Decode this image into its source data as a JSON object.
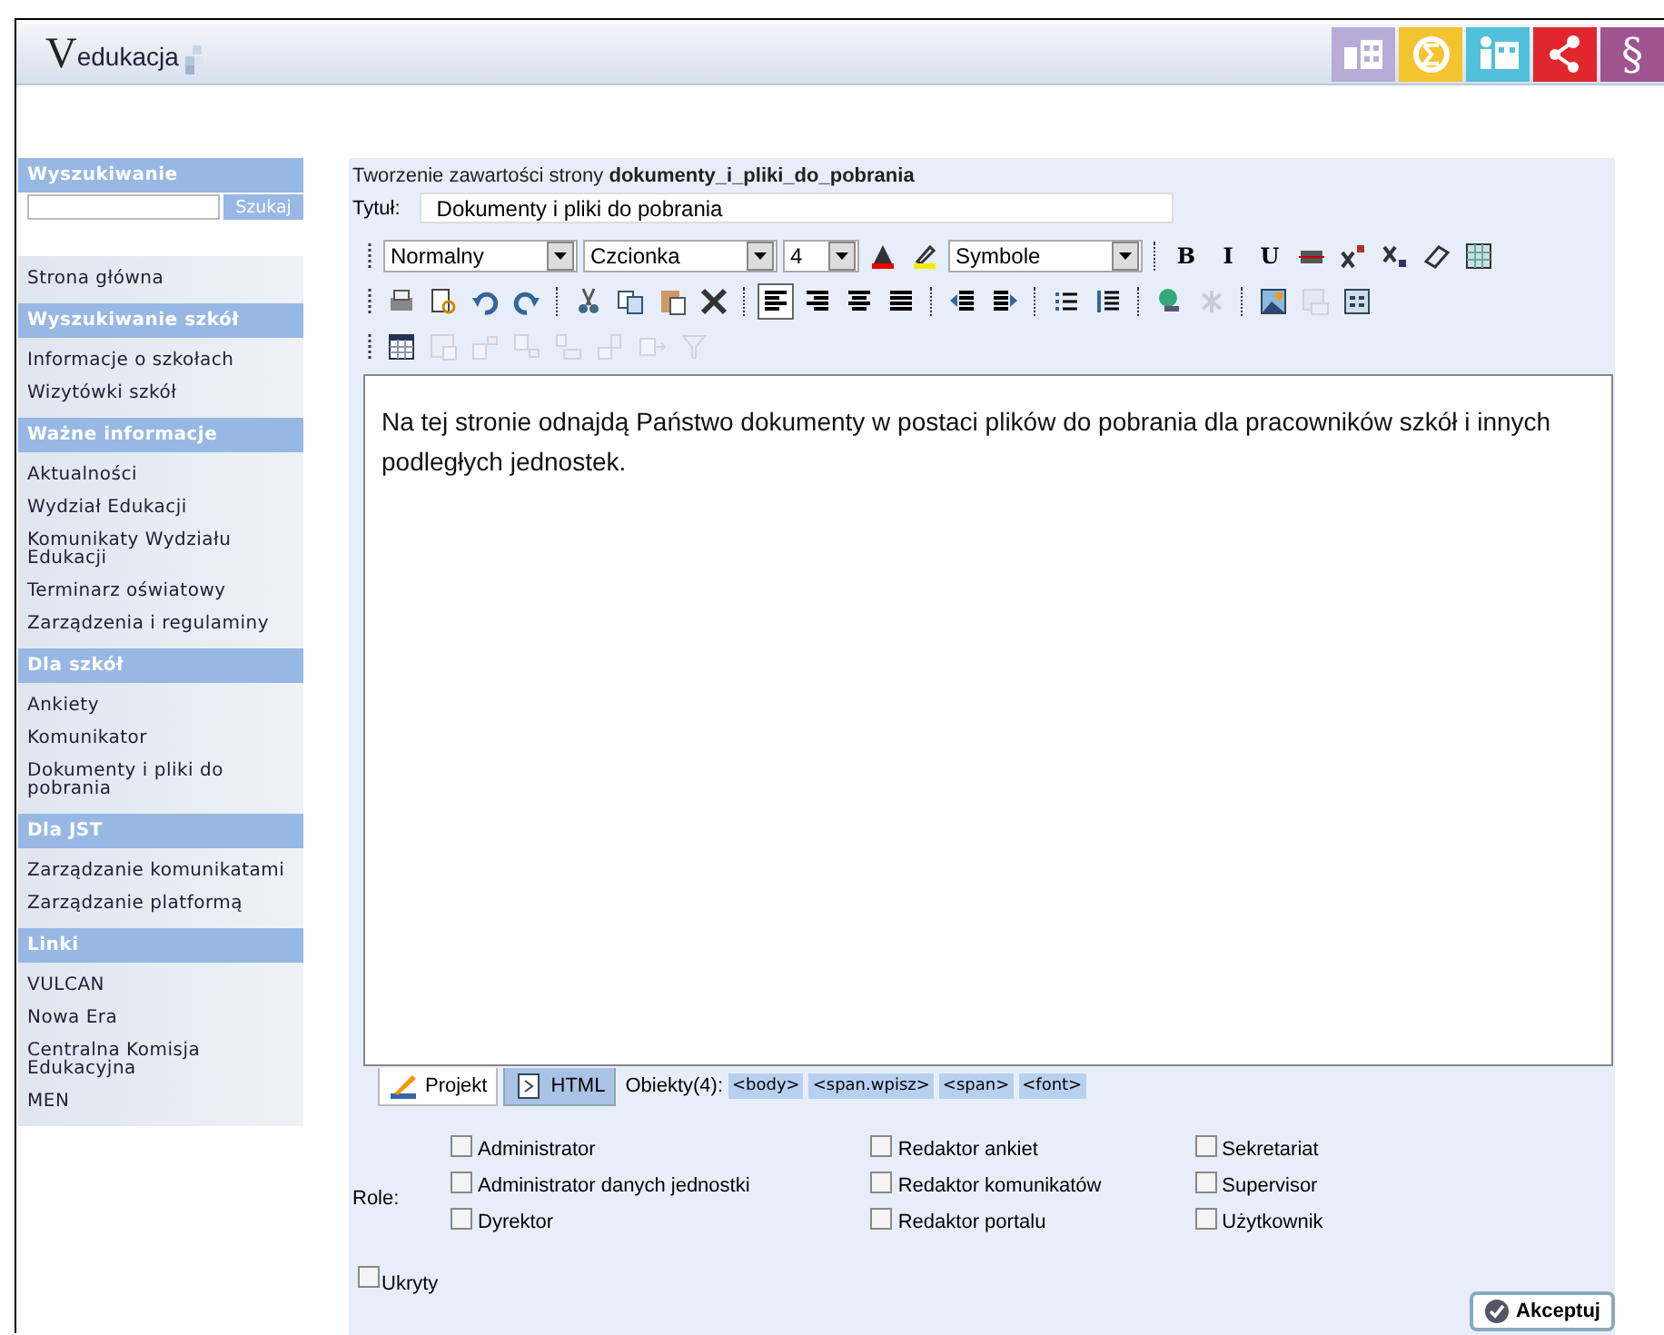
{
  "header": {
    "logo_mark": "V",
    "logo_text": "edukacja",
    "tiles": [
      {
        "kind": "icon",
        "color": "#b7acd8"
      },
      {
        "kind": "icon",
        "color": "#f4c430"
      },
      {
        "kind": "icon",
        "color": "#52c0da"
      },
      {
        "kind": "icon",
        "color": "#e2262e"
      },
      {
        "kind": "glyph",
        "label": "§",
        "color": "#a0548f"
      }
    ]
  },
  "sidebar": {
    "search": {
      "title": "Wyszukiwanie",
      "button": "Szukaj"
    },
    "sections": [
      {
        "items": [
          "Strona główna"
        ]
      },
      {
        "title": "Wyszukiwanie szkół",
        "items": [
          "Informacje o szkołach",
          "Wizytówki szkół"
        ]
      },
      {
        "title": "Ważne informacje",
        "items": [
          "Aktualności",
          "Wydział Edukacji",
          "Komunikaty Wydziału Edukacji",
          "Terminarz oświatowy",
          "Zarządzenia i regulaminy"
        ]
      },
      {
        "title": "Dla szkół",
        "items": [
          "Ankiety",
          "Komunikator",
          "Dokumenty i pliki do pobrania"
        ]
      },
      {
        "title": "Dla JST",
        "items": [
          "Zarządzanie komunikatami",
          "Zarządzanie platformą"
        ]
      },
      {
        "title": "Linki",
        "items": [
          "VULCAN",
          "Nowa Era",
          "Centralna Komisja Edukacyjna",
          "MEN"
        ]
      }
    ]
  },
  "breadcrumb": "Tworzenie zawartości strony **dokumenty_i_pliki_do_pobrania**",
  "title_field": {
    "label": "Tytuł:",
    "value": "Dokumenty i pliki do pobrania"
  },
  "toolbar": [
    [
      {
        "kind": "select",
        "value": "Normalny"
      },
      {
        "kind": "select",
        "value": "Czcionka"
      },
      {
        "kind": "select",
        "value": "4"
      },
      {
        "kind": "button",
        "disabled": false,
        "selected": false
      },
      {
        "kind": "button",
        "disabled": false,
        "selected": false
      },
      {
        "kind": "select",
        "value": "Symbole"
      },
      {
        "kind": "sep"
      },
      {
        "kind": "glyph",
        "label": "B"
      },
      {
        "kind": "glyph",
        "label": "I"
      },
      {
        "kind": "glyph",
        "label": "U"
      },
      {
        "kind": "button",
        "disabled": false,
        "selected": false
      },
      {
        "kind": "button",
        "disabled": false,
        "selected": false
      },
      {
        "kind": "button",
        "disabled": false,
        "selected": false
      },
      {
        "kind": "button",
        "disabled": false,
        "selected": false
      },
      {
        "kind": "button",
        "disabled": false,
        "selected": false
      }
    ],
    [
      {
        "kind": "button",
        "disabled": false,
        "selected": false
      },
      {
        "kind": "button",
        "disabled": false,
        "selected": false
      },
      {
        "kind": "button",
        "disabled": false,
        "selected": false
      },
      {
        "kind": "button",
        "disabled": false,
        "selected": false
      },
      {
        "kind": "sep"
      },
      {
        "kind": "button",
        "disabled": false,
        "selected": false
      },
      {
        "kind": "button",
        "disabled": false,
        "selected": false
      },
      {
        "kind": "button",
        "disabled": false,
        "selected": false
      },
      {
        "kind": "button",
        "disabled": false,
        "selected": false
      },
      {
        "kind": "sep"
      },
      {
        "kind": "button",
        "disabled": false,
        "selected": true
      },
      {
        "kind": "button",
        "disabled": false,
        "selected": false
      },
      {
        "kind": "button",
        "disabled": false,
        "selected": false
      },
      {
        "kind": "button",
        "disabled": false,
        "selected": false
      },
      {
        "kind": "sep"
      },
      {
        "kind": "button",
        "disabled": false,
        "selected": false
      },
      {
        "kind": "button",
        "disabled": false,
        "selected": false
      },
      {
        "kind": "sep"
      },
      {
        "kind": "button",
        "disabled": false,
        "selected": false
      },
      {
        "kind": "button",
        "disabled": false,
        "selected": false
      },
      {
        "kind": "sep"
      },
      {
        "kind": "button",
        "disabled": false,
        "selected": false
      },
      {
        "kind": "button",
        "disabled": true,
        "selected": false
      },
      {
        "kind": "sep"
      },
      {
        "kind": "button",
        "disabled": false,
        "selected": false
      },
      {
        "kind": "button",
        "disabled": true,
        "selected": false
      },
      {
        "kind": "button",
        "disabled": false,
        "selected": false
      }
    ],
    [
      {
        "kind": "button",
        "disabled": false,
        "selected": false
      },
      {
        "kind": "button",
        "disabled": true,
        "selected": false
      },
      {
        "kind": "button",
        "disabled": true,
        "selected": false
      },
      {
        "kind": "button",
        "disabled": true,
        "selected": false
      },
      {
        "kind": "button",
        "disabled": true,
        "selected": false
      },
      {
        "kind": "button",
        "disabled": true,
        "selected": false
      },
      {
        "kind": "button",
        "disabled": true,
        "selected": false
      },
      {
        "kind": "button",
        "disabled": true,
        "selected": false
      }
    ]
  ],
  "editor_text": "Na tej stronie odnajdą Państwo dokumenty w postaci plików do pobrania dla pracowników szkół i innych podległych jednostek.",
  "mode_tabs": [
    {
      "label": "Projekt",
      "selected": true
    },
    {
      "label": "HTML",
      "selected": false
    }
  ],
  "objects": {
    "label": "Obiekty(4):",
    "tags": [
      "<body>",
      "<span.wpisz>",
      "<span>",
      "<font>"
    ]
  },
  "roles": {
    "label": "Role:",
    "columns": [
      [
        {
          "label": "Administrator",
          "checked": false
        },
        {
          "label": "Administrator danych jednostki",
          "checked": false
        },
        {
          "label": "Dyrektor",
          "checked": false
        }
      ],
      [
        {
          "label": "Redaktor ankiet",
          "checked": false
        },
        {
          "label": "Redaktor komunikatów",
          "checked": false
        },
        {
          "label": "Redaktor portalu",
          "checked": false
        }
      ],
      [
        {
          "label": "Sekretariat",
          "checked": false
        },
        {
          "label": "Supervisor",
          "checked": false
        },
        {
          "label": "Użytkownik",
          "checked": false
        }
      ]
    ]
  },
  "hidden": {
    "label": "Ukryty",
    "checked": false
  },
  "accept_button": "Akceptuj"
}
